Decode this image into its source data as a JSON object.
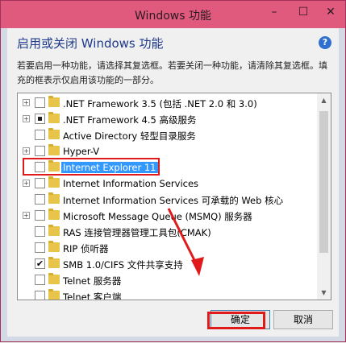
{
  "window": {
    "title": "Windows 功能",
    "controls": {
      "minimize": "–",
      "maximize": "☐",
      "close": "✕"
    }
  },
  "header": {
    "heading": "启用或关闭 Windows 功能",
    "help": "?",
    "description": "若要启用一种功能，请选择其复选框。若要关闭一种功能，请清除其复选框。填充的框表示仅启用该功能的一部分。"
  },
  "features": [
    {
      "label": ".NET Framework 3.5 (包括 .NET 2.0 和 3.0)",
      "expander": "+",
      "state": "unchecked"
    },
    {
      "label": ".NET Framework 4.5 高级服务",
      "expander": "+",
      "state": "partial"
    },
    {
      "label": "Active Directory 轻型目录服务",
      "expander": "",
      "state": "unchecked"
    },
    {
      "label": "Hyper-V",
      "expander": "+",
      "state": "unchecked"
    },
    {
      "label": "Internet Explorer 11",
      "expander": "",
      "state": "unchecked",
      "selected": true
    },
    {
      "label": "Internet Information Services",
      "expander": "+",
      "state": "unchecked"
    },
    {
      "label": "Internet Information Services 可承载的 Web 核心",
      "expander": "",
      "state": "unchecked"
    },
    {
      "label": "Microsoft Message Queue (MSMQ) 服务器",
      "expander": "+",
      "state": "unchecked"
    },
    {
      "label": "RAS 连接管理器管理工具包(CMAK)",
      "expander": "",
      "state": "unchecked"
    },
    {
      "label": "RIP 侦听器",
      "expander": "",
      "state": "unchecked"
    },
    {
      "label": "SMB 1.0/CIFS 文件共享支持",
      "expander": "",
      "state": "checked"
    },
    {
      "label": "Telnet 服务器",
      "expander": "",
      "state": "unchecked"
    },
    {
      "label": "Telnet 客户端",
      "expander": "",
      "state": "unchecked"
    }
  ],
  "buttons": {
    "ok": "确定",
    "cancel": "取消"
  },
  "colors": {
    "title_bar": "#e05a7e",
    "annotation_red": "#e0191b",
    "selection": "#3399ff"
  }
}
